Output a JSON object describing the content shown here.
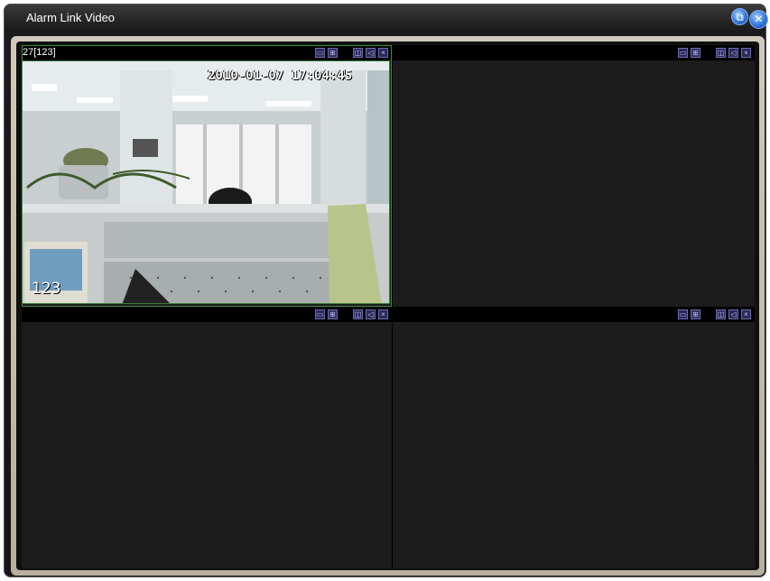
{
  "window": {
    "title": "Alarm Link Video",
    "restore_icon": "restore-icon",
    "close_icon": "close-icon"
  },
  "cells": [
    {
      "label": "27[123]",
      "timestamp": "2010-01-07 17:04:45",
      "camera_name": "123"
    },
    {
      "label": ""
    },
    {
      "label": ""
    },
    {
      "label": ""
    }
  ],
  "toolbar_icons": [
    "record-icon",
    "snapshot-icon",
    "blank",
    "zoom-icon",
    "audio-icon",
    "close-icon"
  ],
  "colors": {
    "active_border": "#3f8f3f",
    "grid_bg": "#1c1c1c"
  }
}
